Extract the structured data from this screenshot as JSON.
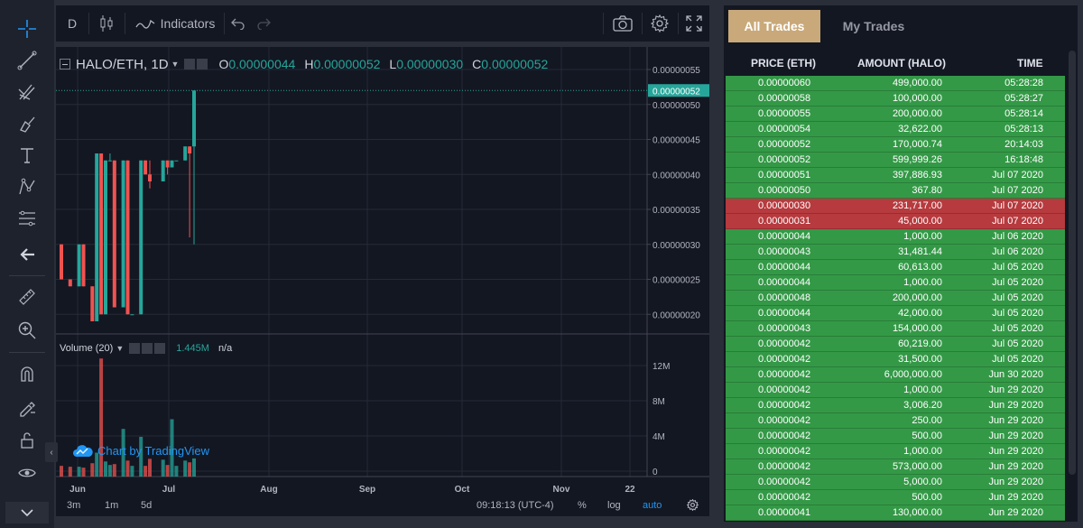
{
  "colors": {
    "up": "#26a69a",
    "down": "#ef5350",
    "buy_row": "#339946",
    "sell_row": "#b63a3e",
    "accent_tab": "#c9a97a",
    "link": "#2196f3"
  },
  "toolbar": {
    "tools": [
      "crosshair-icon",
      "trend-line-icon",
      "pitchfork-icon",
      "brush-icon",
      "text-icon",
      "pattern-icon",
      "fib-icon",
      "back-arrow-icon",
      "ruler-icon",
      "zoom-in-icon",
      "magnet-icon",
      "lock-drawings-icon",
      "unlock-icon",
      "eye-icon"
    ]
  },
  "header": {
    "interval": "D",
    "indicators": "Indicators"
  },
  "legend": {
    "symbol": "HALO/ETH, 1D",
    "o_label": "O",
    "o": "0.00000044",
    "h_label": "H",
    "h": "0.00000052",
    "l_label": "L",
    "l": "0.00000030",
    "c_label": "C",
    "c": "0.00000052"
  },
  "volume": {
    "title": "Volume (20)",
    "value": "1.445M",
    "na": "n/a"
  },
  "watermark": "Chart by TradingView",
  "chart_data": {
    "type": "candlestick",
    "price_axis": [
      "0.00000055",
      "0.00000050",
      "0.00000045",
      "0.00000040",
      "0.00000035",
      "0.00000030",
      "0.00000025",
      "0.00000020"
    ],
    "price_axis_values": [
      55,
      50,
      45,
      40,
      35,
      30,
      25,
      20
    ],
    "price_scale": "1e-8 ETH",
    "last_price_label": "0.00000052",
    "last_price": 52,
    "volume_axis": [
      "12M",
      "8M",
      "4M",
      "0"
    ],
    "volume_axis_values": [
      12,
      8,
      4,
      0
    ],
    "x_labels": [
      "Jun",
      "Jul",
      "Aug",
      "Sep",
      "Oct",
      "Nov",
      "22"
    ],
    "candles": [
      {
        "day": 0,
        "o": 30,
        "h": 30,
        "l": 25,
        "c": 25,
        "v": 0.6
      },
      {
        "day": 2,
        "o": 25,
        "h": 25,
        "l": 24,
        "c": 24,
        "v": 0.5
      },
      {
        "day": 4,
        "o": 24,
        "h": 30,
        "l": 24,
        "c": 30,
        "v": 0.5
      },
      {
        "day": 5,
        "o": 30,
        "h": 30,
        "l": 24,
        "c": 24,
        "v": 0.4
      },
      {
        "day": 7,
        "o": 24,
        "h": 24,
        "l": 19,
        "c": 19,
        "v": 0.9
      },
      {
        "day": 8,
        "o": 19,
        "h": 43,
        "l": 19,
        "c": 43,
        "v": 2.1
      },
      {
        "day": 9,
        "o": 43,
        "h": 43,
        "l": 20,
        "c": 20,
        "v": 12.8
      },
      {
        "day": 10,
        "o": 20,
        "h": 42,
        "l": 20,
        "c": 42,
        "v": 1.1
      },
      {
        "day": 11,
        "o": 42,
        "h": 43,
        "l": 42,
        "c": 42,
        "v": 0.7
      },
      {
        "day": 12,
        "o": 42,
        "h": 42,
        "l": 21,
        "c": 21,
        "v": 0.8
      },
      {
        "day": 14,
        "o": 21,
        "h": 42,
        "l": 21,
        "c": 42,
        "v": 4.8
      },
      {
        "day": 15,
        "o": 42,
        "h": 42,
        "l": 20,
        "c": 20,
        "v": 1.2
      },
      {
        "day": 16,
        "o": 20,
        "h": 20,
        "l": 20,
        "c": 20,
        "v": 0.6
      },
      {
        "day": 18,
        "o": 20,
        "h": 42,
        "l": 20,
        "c": 42,
        "v": 3.9
      },
      {
        "day": 19,
        "o": 42,
        "h": 42,
        "l": 40,
        "c": 40,
        "v": 0.6
      },
      {
        "day": 20,
        "o": 40,
        "h": 42,
        "l": 38,
        "c": 39,
        "v": 1.4
      },
      {
        "day": 23,
        "o": 39,
        "h": 42,
        "l": 39,
        "c": 42,
        "v": 1.3
      },
      {
        "day": 24,
        "o": 42,
        "h": 42,
        "l": 40,
        "c": 41,
        "v": 0.7
      },
      {
        "day": 25,
        "o": 41,
        "h": 42,
        "l": 41,
        "c": 42,
        "v": 5.9
      },
      {
        "day": 26,
        "o": 42,
        "h": 42,
        "l": 42,
        "c": 42,
        "v": 0.6
      },
      {
        "day": 28,
        "o": 42,
        "h": 44,
        "l": 42,
        "c": 44,
        "v": 1.2
      },
      {
        "day": 29,
        "o": 44,
        "h": 44,
        "l": 31,
        "c": 43,
        "v": 1.0
      },
      {
        "day": 30,
        "o": 44,
        "h": 52,
        "l": 30,
        "c": 52,
        "v": 1.445
      }
    ]
  },
  "bottom": {
    "ranges": [
      "3m",
      "1m",
      "5d"
    ],
    "time": "09:18:13 (UTC-4)",
    "percent": "%",
    "log": "log",
    "auto": "auto"
  },
  "trades": {
    "tab_all": "All Trades",
    "tab_my": "My Trades",
    "headers": {
      "price": "PRICE (ETH)",
      "amount": "AMOUNT (HALO)",
      "time": "TIME"
    },
    "rows": [
      {
        "price": "0.00000060",
        "amount": "499,000.00",
        "time": "05:28:28",
        "side": "buy"
      },
      {
        "price": "0.00000058",
        "amount": "100,000.00",
        "time": "05:28:27",
        "side": "buy"
      },
      {
        "price": "0.00000055",
        "amount": "200,000.00",
        "time": "05:28:14",
        "side": "buy"
      },
      {
        "price": "0.00000054",
        "amount": "32,622.00",
        "time": "05:28:13",
        "side": "buy"
      },
      {
        "price": "0.00000052",
        "amount": "170,000.74",
        "time": "20:14:03",
        "side": "buy"
      },
      {
        "price": "0.00000052",
        "amount": "599,999.26",
        "time": "16:18:48",
        "side": "buy"
      },
      {
        "price": "0.00000051",
        "amount": "397,886.93",
        "time": "Jul 07 2020",
        "side": "buy"
      },
      {
        "price": "0.00000050",
        "amount": "367.80",
        "time": "Jul 07 2020",
        "side": "buy"
      },
      {
        "price": "0.00000030",
        "amount": "231,717.00",
        "time": "Jul 07 2020",
        "side": "sell"
      },
      {
        "price": "0.00000031",
        "amount": "45,000.00",
        "time": "Jul 07 2020",
        "side": "sell"
      },
      {
        "price": "0.00000044",
        "amount": "1,000.00",
        "time": "Jul 06 2020",
        "side": "buy"
      },
      {
        "price": "0.00000043",
        "amount": "31,481.44",
        "time": "Jul 06 2020",
        "side": "buy"
      },
      {
        "price": "0.00000044",
        "amount": "60,613.00",
        "time": "Jul 05 2020",
        "side": "buy"
      },
      {
        "price": "0.00000044",
        "amount": "1,000.00",
        "time": "Jul 05 2020",
        "side": "buy"
      },
      {
        "price": "0.00000048",
        "amount": "200,000.00",
        "time": "Jul 05 2020",
        "side": "buy"
      },
      {
        "price": "0.00000044",
        "amount": "42,000.00",
        "time": "Jul 05 2020",
        "side": "buy"
      },
      {
        "price": "0.00000043",
        "amount": "154,000.00",
        "time": "Jul 05 2020",
        "side": "buy"
      },
      {
        "price": "0.00000042",
        "amount": "60,219.00",
        "time": "Jul 05 2020",
        "side": "buy"
      },
      {
        "price": "0.00000042",
        "amount": "31,500.00",
        "time": "Jul 05 2020",
        "side": "buy"
      },
      {
        "price": "0.00000042",
        "amount": "6,000,000.00",
        "time": "Jun 30 2020",
        "side": "buy"
      },
      {
        "price": "0.00000042",
        "amount": "1,000.00",
        "time": "Jun 29 2020",
        "side": "buy"
      },
      {
        "price": "0.00000042",
        "amount": "3,006.20",
        "time": "Jun 29 2020",
        "side": "buy"
      },
      {
        "price": "0.00000042",
        "amount": "250.00",
        "time": "Jun 29 2020",
        "side": "buy"
      },
      {
        "price": "0.00000042",
        "amount": "500.00",
        "time": "Jun 29 2020",
        "side": "buy"
      },
      {
        "price": "0.00000042",
        "amount": "1,000.00",
        "time": "Jun 29 2020",
        "side": "buy"
      },
      {
        "price": "0.00000042",
        "amount": "573,000.00",
        "time": "Jun 29 2020",
        "side": "buy"
      },
      {
        "price": "0.00000042",
        "amount": "5,000.00",
        "time": "Jun 29 2020",
        "side": "buy"
      },
      {
        "price": "0.00000042",
        "amount": "500.00",
        "time": "Jun 29 2020",
        "side": "buy"
      },
      {
        "price": "0.00000041",
        "amount": "130,000.00",
        "time": "Jun 29 2020",
        "side": "buy"
      }
    ]
  }
}
